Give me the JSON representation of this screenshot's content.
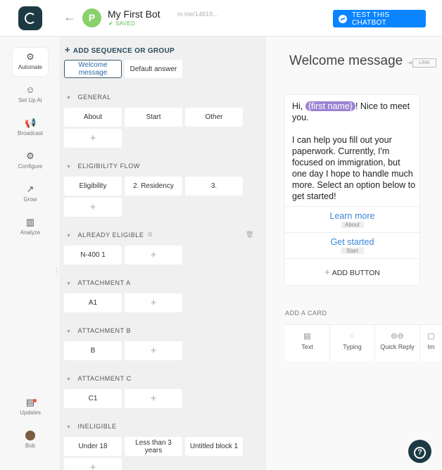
{
  "topbar": {
    "bot_initial": "P",
    "bot_name": "My First Bot",
    "saved_label": "SAVED",
    "bot_url": "m.me/14819...",
    "test_button": "TEST THIS CHATBOT"
  },
  "sidebar": {
    "items": [
      {
        "label": "Automate",
        "icon": "automate-icon"
      },
      {
        "label": "Set Up AI",
        "icon": "ai-icon"
      },
      {
        "label": "Broadcast",
        "icon": "megaphone-icon"
      },
      {
        "label": "Configure",
        "icon": "gear-icon"
      },
      {
        "label": "Grow",
        "icon": "growth-icon"
      },
      {
        "label": "Analyze",
        "icon": "bar-chart-icon"
      }
    ],
    "updates_label": "Updates",
    "user_label": "Bob"
  },
  "middle": {
    "add_sequence": "ADD SEQUENCE OR GROUP",
    "top_pills": [
      "Welcome message",
      "Default answer"
    ],
    "groups": [
      {
        "name": "GENERAL",
        "blocks": [
          "About",
          "Start",
          "Other"
        ]
      },
      {
        "name": "ELIGIBILITY FLOW",
        "blocks": [
          "Eligibility",
          "2. Residency",
          "3."
        ]
      },
      {
        "name": "ALREADY ELIGIBLE",
        "blocks": [
          "N-400 1"
        ]
      },
      {
        "name": "ATTACHMENT A",
        "blocks": [
          "A1"
        ]
      },
      {
        "name": "ATTACHMENT B",
        "blocks": [
          "B"
        ]
      },
      {
        "name": "ATTACHMENT C",
        "blocks": [
          "C1"
        ]
      },
      {
        "name": "INELIGIBLE",
        "blocks": [
          "Under 18",
          "Less than 3 years",
          "Untitled block 1"
        ]
      }
    ],
    "plus": "+"
  },
  "right": {
    "title": "Welcome message",
    "link_label": "LINK",
    "message": {
      "greeting": "Hi, ",
      "tag": "{first name}",
      "after_tag": "! Nice to meet you.",
      "body": "I can help you fill out your paperwork. Currently, I'm focused on immigration, but one day I hope to handle much more. Select an option below to get started!"
    },
    "buttons": [
      {
        "label": "Learn more",
        "sub": "About"
      },
      {
        "label": "Get started",
        "sub": "Start"
      }
    ],
    "add_button": "ADD BUTTON",
    "add_card": "ADD A CARD",
    "card_types": [
      {
        "label": "Text",
        "icon": "text-card-icon"
      },
      {
        "label": "Typing",
        "icon": "typing-icon"
      },
      {
        "label": "Quick Reply",
        "icon": "quick-reply-icon"
      },
      {
        "label": "Im",
        "icon": "image-icon"
      }
    ]
  }
}
